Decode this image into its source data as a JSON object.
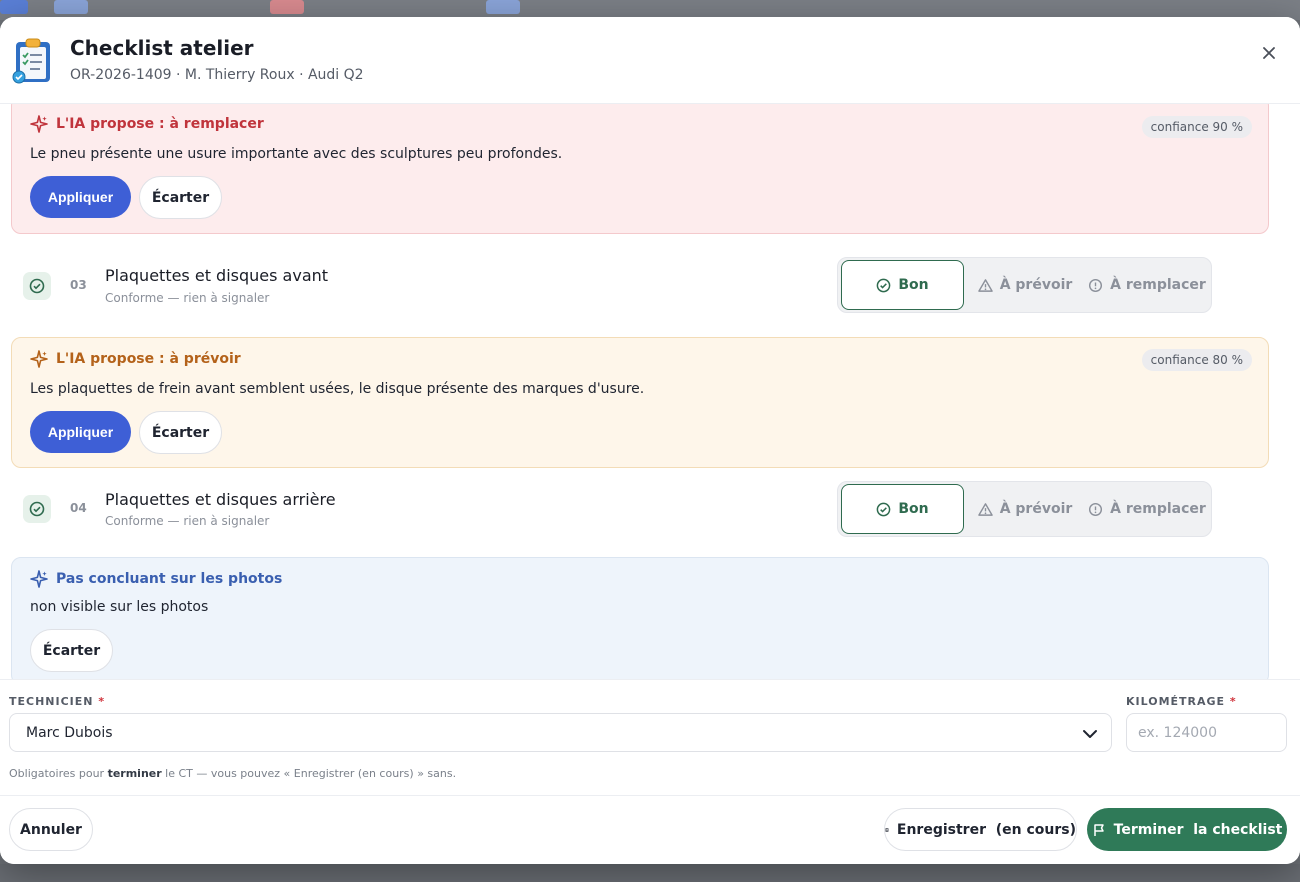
{
  "modal": {
    "title": "Checklist atelier",
    "subtitle": "OR-2026-1409 · M. Thierry Roux · Audi Q2",
    "close_icon": "close-icon",
    "header_icon": "clipboard-icon"
  },
  "ai_suggestions": [
    {
      "heading": "L'IA propose : à remplacer",
      "text": "Le pneu présente une usure importante avec des sculptures peu profondes.",
      "confidence": "confiance 90 %",
      "apply_label": "Appliquer",
      "dismiss_label": "Écarter",
      "color": "#c0343c"
    },
    {
      "heading": "L'IA propose : à prévoir",
      "text": "Les plaquettes de frein avant semblent usées, le disque présente des marques d'usure.",
      "confidence": "confiance 80 %",
      "apply_label": "Appliquer",
      "dismiss_label": "Écarter",
      "color": "#b4621a"
    },
    {
      "heading": "Pas concluant sur les photos",
      "text": "non visible sur les photos",
      "dismiss_label": "Écarter",
      "color": "#3a5fb0"
    }
  ],
  "checklist_items": [
    {
      "number": "03",
      "title": "Plaquettes et disques avant",
      "subtitle": "Conforme — rien à signaler",
      "options": [
        "Bon",
        "À prévoir",
        "À remplacer"
      ],
      "selected": "Bon"
    },
    {
      "number": "04",
      "title": "Plaquettes et disques arrière",
      "subtitle": "Conforme — rien à signaler",
      "options": [
        "Bon",
        "À prévoir",
        "À remplacer"
      ],
      "selected": "Bon"
    }
  ],
  "form": {
    "technician_label": "TECHNICIEN",
    "technician_value": "Marc Dubois",
    "mileage_label": "KILOMÉTRAGE",
    "mileage_placeholder": "ex. 124000",
    "required_mark": "*",
    "hint_prefix": "Obligatoires pour",
    "hint_bold": "terminer",
    "hint_suffix": "le CT — vous pouvez « Enregistrer (en cours) » sans."
  },
  "footer": {
    "cancel_label": "Annuler",
    "save_label": "Enregistrer  (en cours)",
    "finish_label": "Terminer  la checklist"
  },
  "colors": {
    "primary": "#3e5fd6",
    "success": "#2f7a58",
    "good": "#2f6b4f"
  }
}
